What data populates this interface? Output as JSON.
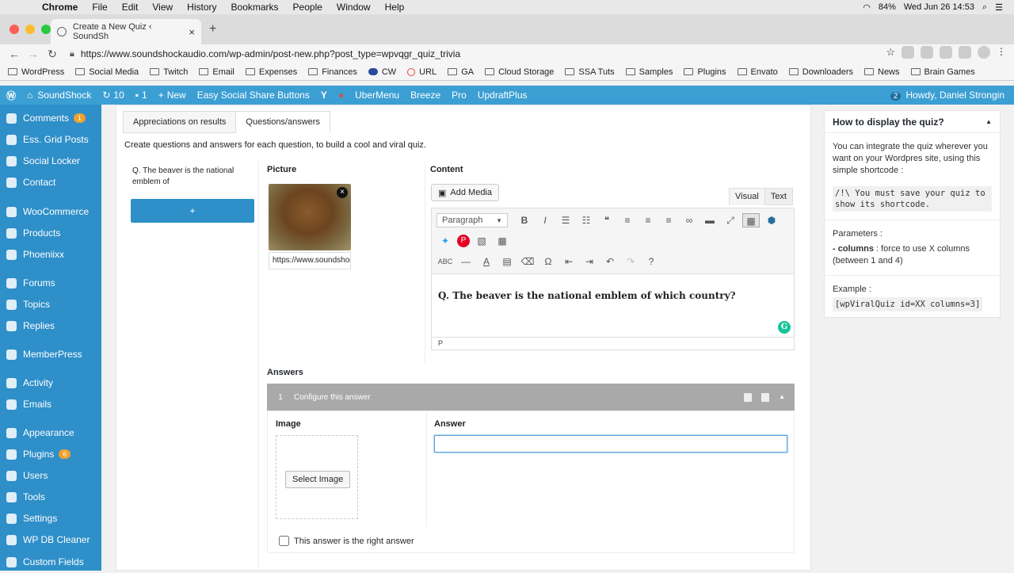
{
  "mac_menu": {
    "app": "Chrome",
    "items": [
      "File",
      "Edit",
      "View",
      "History",
      "Bookmarks",
      "People",
      "Window",
      "Help"
    ],
    "battery": "84%",
    "datetime": "Wed Jun 26  14:53"
  },
  "browser": {
    "tab_title": "Create a New Quiz ‹ SoundSh",
    "url": "https://www.soundshockaudio.com/wp-admin/post-new.php?post_type=wpvqgr_quiz_trivia",
    "bookmarks": [
      "WordPress",
      "Social Media",
      "Twitch",
      "Email",
      "Expenses",
      "Finances",
      "CW",
      "URL",
      "GA",
      "Cloud Storage",
      "SSA Tuts",
      "Samples",
      "Plugins",
      "Envato",
      "Downloaders",
      "News",
      "Brain Games"
    ]
  },
  "adminbar": {
    "site": "SoundShock",
    "updates": "10",
    "comments": "1",
    "new": "New",
    "plugins": [
      "Easy Social Share Buttons",
      "UberMenu",
      "Breeze",
      "Pro",
      "UpdraftPlus"
    ],
    "notifications": "2",
    "howdy": "Howdy, Daniel Strongin"
  },
  "sidebar": {
    "items": [
      {
        "label": "Comments",
        "badge": "1"
      },
      {
        "label": "Ess. Grid Posts"
      },
      {
        "label": "Social Locker"
      },
      {
        "label": "Contact"
      },
      {
        "label": "WooCommerce"
      },
      {
        "label": "Products"
      },
      {
        "label": "Phoeniixx"
      },
      {
        "label": "Forums"
      },
      {
        "label": "Topics"
      },
      {
        "label": "Replies"
      },
      {
        "label": "MemberPress"
      },
      {
        "label": "Activity"
      },
      {
        "label": "Emails"
      },
      {
        "label": "Appearance"
      },
      {
        "label": "Plugins",
        "badge": "6"
      },
      {
        "label": "Users"
      },
      {
        "label": "Tools"
      },
      {
        "label": "Settings"
      },
      {
        "label": "WP DB Cleaner"
      },
      {
        "label": "Custom Fields"
      }
    ]
  },
  "main": {
    "tabs": [
      "Appreciations on results",
      "Questions/answers"
    ],
    "intro": "Create questions and answers for each question, to build a cool and viral quiz.",
    "question_item": "Q. The beaver is the national emblem of",
    "add_label": "+",
    "picture_label": "Picture",
    "picture_url": "https://www.soundshockaudio.com",
    "content_label": "Content",
    "add_media": "Add Media",
    "editor_tabs": [
      "Visual",
      "Text"
    ],
    "format_select": "Paragraph",
    "editor_text": "Q. The beaver is the national emblem of which country?",
    "path": "P",
    "answers_label": "Answers",
    "answer_number": "1",
    "configure_label": "Configure this answer",
    "image_label": "Image",
    "select_image": "Select Image",
    "answer_label": "Answer",
    "answer_value": "",
    "right_answer": "This answer is the right answer"
  },
  "panel": {
    "title": "How to display the quiz?",
    "intro": "You can integrate the quiz wherever you want on your Wordpres site, using this simple shortcode :",
    "code": "/!\\ You must save your quiz to show its shortcode.",
    "params_title": "Parameters :",
    "param_name": "- columns",
    "param_desc": " : force to use X columns (between 1 and 4)",
    "example_title": "Example :",
    "example_code": "[wpViralQuiz id=XX columns=3]"
  },
  "colors": {
    "admin_bar": "#3b9fd3",
    "sidebar": "#2e8fc9",
    "badge": "#f0a02b"
  }
}
